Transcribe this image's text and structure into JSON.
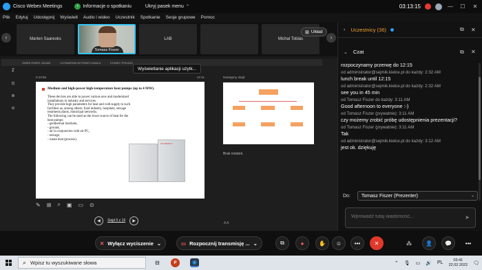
{
  "titlebar": {
    "app_title": "Cisco Webex Meetings",
    "info_label": "Informacje o spotkaniu",
    "hide_menu_label": "Ukryj pasek menu",
    "time": "03:13:15",
    "minimize": "—",
    "maximize": "☐",
    "close": "✕"
  },
  "menu": {
    "items": [
      "Plik",
      "Edytuj",
      "Udostępnij",
      "Wyświetl",
      "Audio i wideo",
      "Uczestnik",
      "Spotkanie",
      "Sesje grupowe",
      "Pomoc"
    ]
  },
  "strip": {
    "prev": "‹",
    "next": "›",
    "tiles": [
      "Marten Saareoks",
      "Tomasz Fiszer",
      "LAB",
      "",
      "Michal Tobiás"
    ],
    "layout_label": "Układ"
  },
  "share": {
    "top_items": [
      "ZMIEŃ PASEK ZADAŃ",
      "USTAWIENIA WYŚWIETLANIA ▾",
      "KONIEC POKAZU"
    ],
    "tooltip": "Wyświetlanie aplikacji użytk...",
    "left_tools": [
      "Ꮖ̸",
      "⊡",
      "⊕",
      "⊖"
    ],
    "slide_timer": "0:10:56",
    "slide_clock": "12:41",
    "slide": {
      "title": "Medium and high-power high-temperature heat pumps (up to 4 MW).",
      "lines": [
        "These devices are able to power various new and modernized",
        "installations in industry and services.",
        "They provide high parameters for heat and cold supply to such",
        "facilities as, among others: food industry, hospitals, sewage",
        "treatment plants, municipal networks.",
        "The following can be used as the lower source of heat for the",
        "heat pumps:",
        "- geothermal borehole,",
        "- ground,",
        "- air in conjunction with air PC,",
        "- sewage,",
        "- waste heat (process)."
      ],
      "unit_label": "HP ENERGY"
    },
    "next_label": "Następny slajd",
    "notes": "Brak notatek.",
    "slide_counter": "Slajd 5 z 19",
    "aa": "A A"
  },
  "controls": {
    "mute_label": "Wyłącz wyciszenie",
    "stream_label": "Rozpocznij transmisję ...",
    "chevron": "⌄",
    "more": "•••",
    "end": "✕"
  },
  "panel": {
    "participants_title": "Uczestnicy (36)",
    "chat_title": "Czat",
    "messages": [
      {
        "from": "",
        "text": "rozpoczynamy przerwę do 12:15"
      },
      {
        "from": "od administrator@sejmik.kielce.pl do każdy:    2:32 AM",
        "text": "lunch break until 12:15"
      },
      {
        "from": "od administrator@sejmik.kielce.pl do każdy:    2:32 AM",
        "text": "see you in 45 min"
      },
      {
        "from": "od Tomasz Fiszer do każdy:    3:11 AM",
        "text": "Good afternoon to everyone :-)"
      },
      {
        "from": "od Tomasz Fiszer (prywatnie):    3:11 AM",
        "text": "czy możemy zrobić próbę udostępnienia prezentacji?"
      },
      {
        "from": "od Tomasz Fiszer (prywatnie):    3:11 AM",
        "text": "Tak"
      },
      {
        "from": "od administrator@sejmik.kielce.pl do każdy:    3:12 AM",
        "text": "jest ok. dziękuję"
      }
    ],
    "to_label": "Do:",
    "to_value": "Tomasz Fiszer (Prezenter)",
    "input_placeholder": "Wprowadź tutaj wiadomość..."
  },
  "taskbar": {
    "search_placeholder": "Wpisz tu wyszukiwane słowa",
    "time": "03:41",
    "date": "22.02.2022"
  }
}
